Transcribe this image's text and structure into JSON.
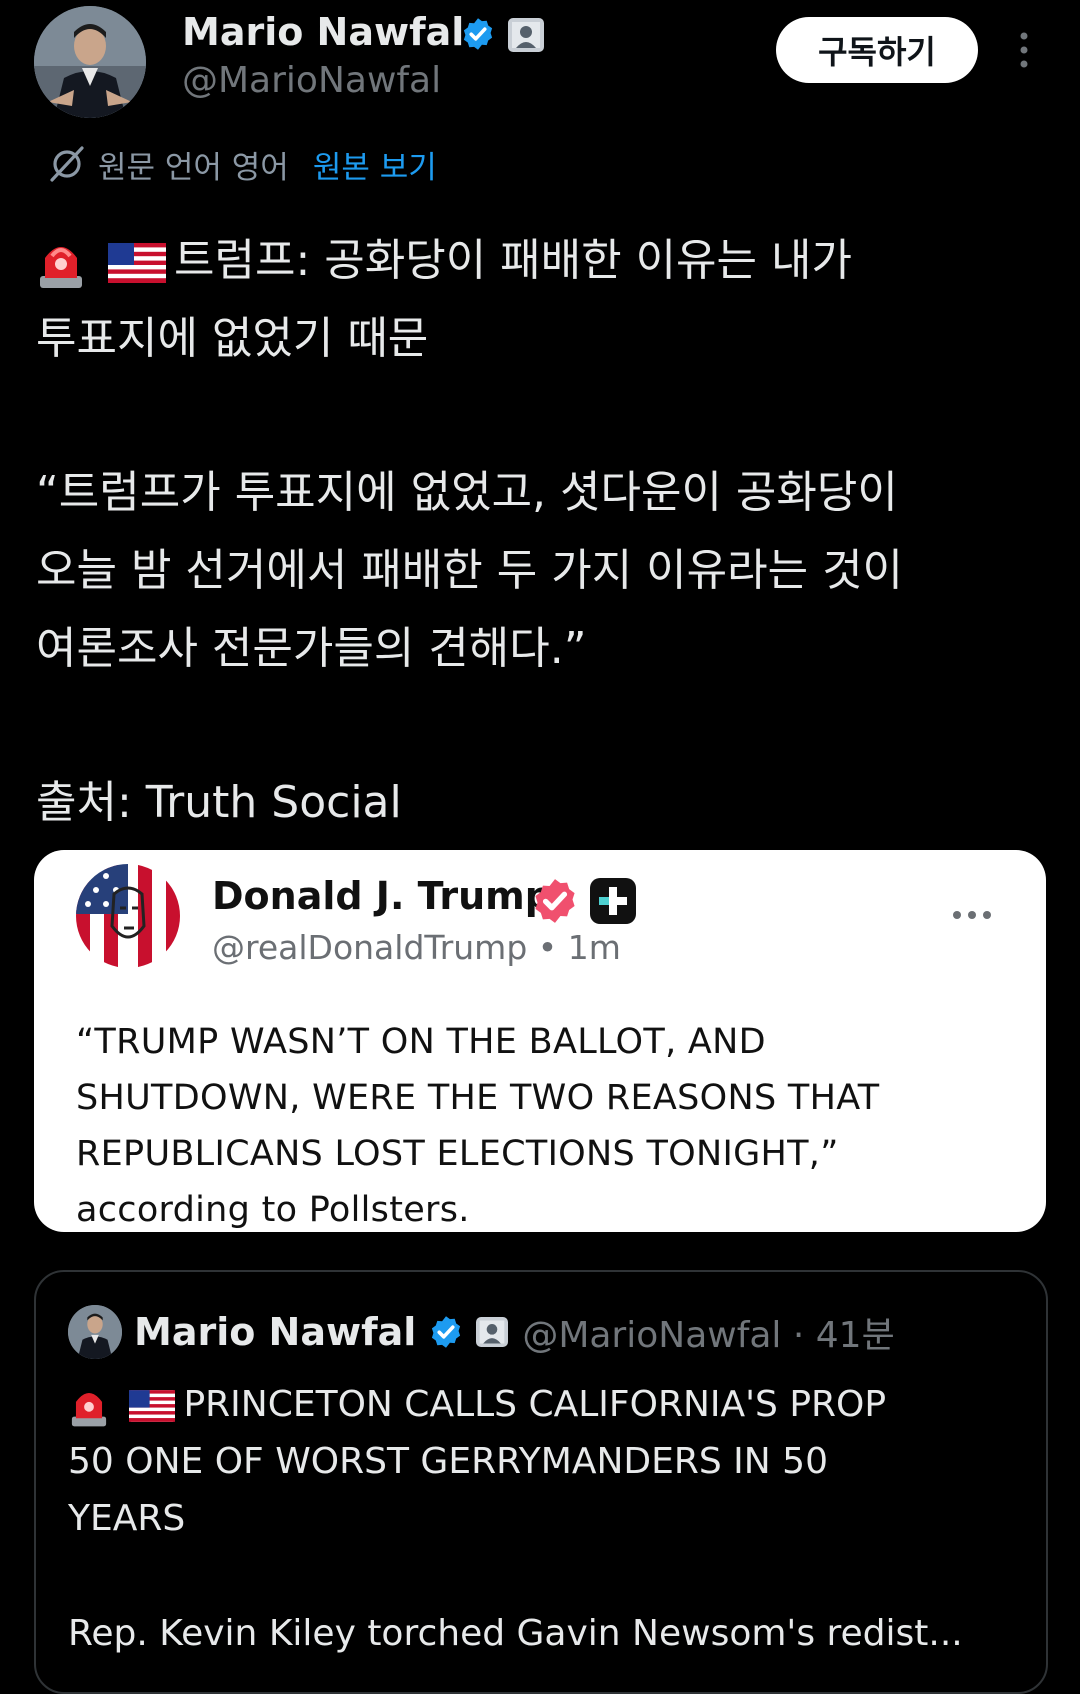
{
  "header": {
    "author_name": "Mario Nawfal",
    "handle": "@MarioNawfal",
    "subscribe_label": "구독하기"
  },
  "translation": {
    "label": "원문 언어 영어",
    "show_original": "원본 보기"
  },
  "tweet": {
    "line1": "트럼프: 공화당이 패배한 이유는 내가",
    "line2": "투표지에 없었기 때문",
    "quote1": "“트럼프가 투표지에 없었고, 셧다운이 공화당이",
    "quote2": "오늘 밤 선거에서 패배한 두 가지 이유라는 것이",
    "quote3": "여론조사 전문가들의 견해다.”",
    "source": "출처: Truth Social"
  },
  "embed": {
    "name": "Donald J. Trump",
    "handle_time": "@realDonaldTrump • 1m",
    "line1": "“TRUMP WASN’T ON THE BALLOT, AND",
    "line2": "SHUTDOWN, WERE THE TWO REASONS THAT",
    "line3": "REPUBLICANS LOST ELECTIONS TONIGHT,”",
    "line4": "according to Pollsters."
  },
  "quoted_post": {
    "name": "Mario Nawfal",
    "meta": "@MarioNawfal · 41분",
    "line1": "PRINCETON CALLS CALIFORNIA'S PROP",
    "line2": "50 ONE OF WORST GERRYMANDERS IN 50",
    "line3": "YEARS",
    "line4": "Rep. Kevin Kiley torched Gavin Newsom's redist..."
  },
  "colors": {
    "background": "#000000",
    "text": "#e7e9ea",
    "muted": "#71767b",
    "link": "#1d9bf0",
    "verified_blue": "#1d9bf0",
    "truth_verified": "#f0506e"
  },
  "icons": [
    "verified-badge-icon",
    "affiliate-badge-icon",
    "more-vertical-icon",
    "translate-icon",
    "siren-emoji-icon",
    "us-flag-emoji-icon",
    "more-horizontal-icon",
    "plus-badge-icon"
  ]
}
